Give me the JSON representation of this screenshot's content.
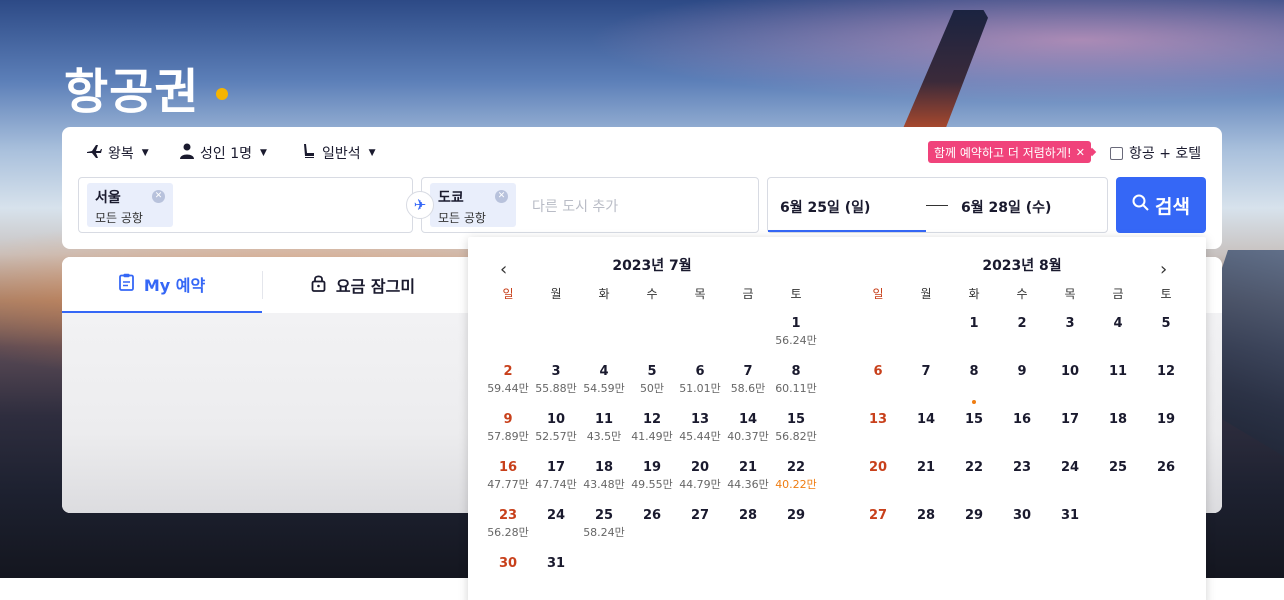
{
  "page": {
    "title": "항공권"
  },
  "options": {
    "trip_type": "왕복",
    "passengers": "성인 1명",
    "cabin": "일반석",
    "promo": "함께 예약하고 더 저렴하게!",
    "hotel_combo": "항공 + 호텔"
  },
  "origin": {
    "city": "서울",
    "airport": "모든 공항"
  },
  "destination": {
    "city": "도쿄",
    "airport": "모든 공항",
    "add_placeholder": "다른 도시 추가"
  },
  "dates": {
    "start": "6월 25일 (일)",
    "end": "6월 28일 (수)"
  },
  "search_button": "검색",
  "tabs": [
    {
      "label": "My 예약"
    },
    {
      "label": "요금 잠그미"
    }
  ],
  "calendar": {
    "weekdays": [
      "일",
      "월",
      "화",
      "수",
      "목",
      "금",
      "토"
    ],
    "months": [
      {
        "title": "2023년 7월",
        "days": [
          null,
          null,
          null,
          null,
          null,
          null,
          {
            "d": "1",
            "p": "56.24만"
          },
          {
            "d": "2",
            "p": "59.44만"
          },
          {
            "d": "3",
            "p": "55.88만"
          },
          {
            "d": "4",
            "p": "54.59만"
          },
          {
            "d": "5",
            "p": "50만"
          },
          {
            "d": "6",
            "p": "51.01만"
          },
          {
            "d": "7",
            "p": "58.6만"
          },
          {
            "d": "8",
            "p": "60.11만"
          },
          {
            "d": "9",
            "p": "57.89만"
          },
          {
            "d": "10",
            "p": "52.57만"
          },
          {
            "d": "11",
            "p": "43.5만"
          },
          {
            "d": "12",
            "p": "41.49만"
          },
          {
            "d": "13",
            "p": "45.44만"
          },
          {
            "d": "14",
            "p": "40.37만"
          },
          {
            "d": "15",
            "p": "56.82만"
          },
          {
            "d": "16",
            "p": "47.77만"
          },
          {
            "d": "17",
            "p": "47.74만"
          },
          {
            "d": "18",
            "p": "43.48만"
          },
          {
            "d": "19",
            "p": "49.55만"
          },
          {
            "d": "20",
            "p": "44.79만"
          },
          {
            "d": "21",
            "p": "44.36만"
          },
          {
            "d": "22",
            "p": "40.22만",
            "low": true
          },
          {
            "d": "23",
            "p": "56.28만"
          },
          {
            "d": "24",
            "p": ""
          },
          {
            "d": "25",
            "p": "58.24만"
          },
          {
            "d": "26",
            "p": ""
          },
          {
            "d": "27",
            "p": ""
          },
          {
            "d": "28",
            "p": ""
          },
          {
            "d": "29",
            "p": ""
          },
          {
            "d": "30",
            "p": ""
          },
          {
            "d": "31",
            "p": ""
          }
        ]
      },
      {
        "title": "2023년 8월",
        "days": [
          null,
          null,
          {
            "d": "1"
          },
          {
            "d": "2"
          },
          {
            "d": "3"
          },
          {
            "d": "4"
          },
          {
            "d": "5"
          },
          {
            "d": "6"
          },
          {
            "d": "7"
          },
          {
            "d": "8"
          },
          {
            "d": "9"
          },
          {
            "d": "10"
          },
          {
            "d": "11"
          },
          {
            "d": "12"
          },
          {
            "d": "13"
          },
          {
            "d": "14"
          },
          {
            "d": "15",
            "dot": true
          },
          {
            "d": "16"
          },
          {
            "d": "17"
          },
          {
            "d": "18"
          },
          {
            "d": "19"
          },
          {
            "d": "20"
          },
          {
            "d": "21"
          },
          {
            "d": "22"
          },
          {
            "d": "23"
          },
          {
            "d": "24"
          },
          {
            "d": "25"
          },
          {
            "d": "26"
          },
          {
            "d": "27"
          },
          {
            "d": "28"
          },
          {
            "d": "29"
          },
          {
            "d": "30"
          },
          {
            "d": "31"
          }
        ]
      }
    ]
  },
  "colors": {
    "accent": "#3567f6",
    "brand_dot": "#f5b400",
    "promo": "#f0437b",
    "sunday": "#c8401b",
    "low_price": "#ef7d12"
  },
  "icons": {
    "trip": "airplane-icon",
    "passengers": "person-icon",
    "cabin": "seat-icon",
    "swap": "airplane-swap-icon",
    "search": "search-icon",
    "my_booking": "clipboard-icon",
    "fare_lock": "lock-icon"
  }
}
